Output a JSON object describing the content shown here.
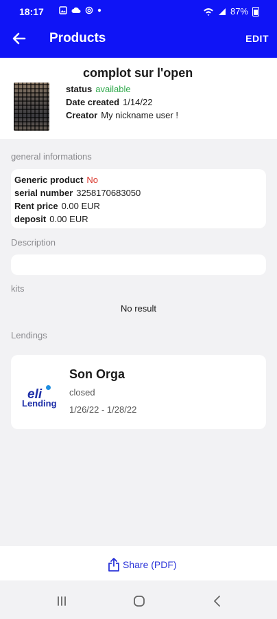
{
  "status_bar": {
    "time": "18:17",
    "battery": "87%"
  },
  "app_bar": {
    "title": "Products",
    "edit_label": "EDIT"
  },
  "product": {
    "title": "complot sur l'open",
    "status_label": "status",
    "status_value": "available",
    "date_label": "Date created",
    "date_value": "1/14/22",
    "creator_label": "Creator",
    "creator_value": "My nickname user !"
  },
  "general": {
    "section_label": "general informations",
    "generic_label": "Generic product",
    "generic_value": "No",
    "serial_label": "serial number",
    "serial_value": "3258170683050",
    "rent_label": "Rent price",
    "rent_value": "0.00 EUR",
    "deposit_label": "deposit",
    "deposit_value": "0.00 EUR"
  },
  "description": {
    "section_label": "Description",
    "value": ""
  },
  "kits": {
    "section_label": "kits",
    "empty_text": "No result"
  },
  "lendings": {
    "section_label": "Lendings",
    "items": [
      {
        "logo_top": "eli",
        "logo_bottom": "Lending",
        "title": "Son Orga",
        "status": "closed",
        "dates": "1/26/22 - 1/28/22"
      }
    ]
  },
  "share": {
    "label": "Share (PDF)"
  },
  "colors": {
    "primary": "#0f14f6",
    "available": "#2ea84a",
    "no": "#d9362b",
    "share": "#2a33d8"
  }
}
